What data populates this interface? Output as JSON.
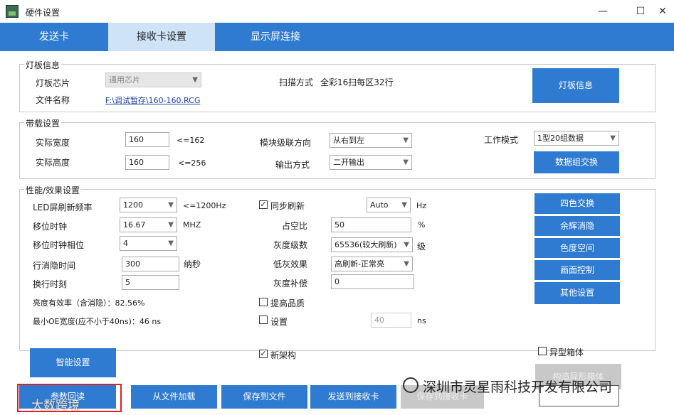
{
  "window": {
    "title": "硬件设置",
    "minimize": "—",
    "maximize": "☐",
    "close": "✕"
  },
  "tabs": [
    {
      "label": "发送卡"
    },
    {
      "label": "接收卡设置"
    },
    {
      "label": "显示屏连接"
    }
  ],
  "panel_info": {
    "legend": "灯板信息",
    "chip_label": "灯板芯片",
    "chip_value": "通用芯片",
    "file_label": "文件名称",
    "file_value": "F:\\调试暂存\\160-160.RCG",
    "scan_label": "扫描方式",
    "scan_value": "全彩16扫每区32行",
    "info_button": "灯板信息"
  },
  "panel_load": {
    "legend": "带载设置",
    "width_label": "实际宽度",
    "width_value": "160",
    "width_hint": "<=162",
    "height_label": "实际高度",
    "height_value": "160",
    "height_hint": "<=256",
    "cascade_label": "模块级联方向",
    "cascade_value": "从右到左",
    "output_label": "输出方式",
    "output_value": "二开输出",
    "mode_label": "工作模式",
    "mode_value": "1型20组数据",
    "swap_button": "数据组交换"
  },
  "panel_perf": {
    "legend": "性能/效果设置",
    "refresh_label": "LED屏刷新频率",
    "refresh_value": "1200",
    "refresh_hint": "<=1200Hz",
    "shift_clock_label": "移位时钟",
    "shift_clock_value": "16.67",
    "shift_clock_unit": "MHZ",
    "phase_label": "移位时钟相位",
    "phase_value": "4",
    "blank_label": "行消隐时间",
    "blank_value": "300",
    "blank_unit": "纳秒",
    "line_change_label": "换行时刻",
    "line_change_value": "5",
    "efficiency_text": "亮度有效率（含消隐）：82.56%",
    "min_oe_text": "最小OE宽度(应不小于40ns)：46 ns",
    "sync_label": "同步刷新",
    "sync_checked": true,
    "sync_value": "Auto",
    "sync_unit": "Hz",
    "duty_label": "占空比",
    "duty_value": "50",
    "duty_unit": "%",
    "gray_label": "灰度级数",
    "gray_value": "65536(较大刷新)",
    "gray_unit": "级",
    "lowgray_label": "低灰效果",
    "lowgray_value": "高刷新-正常亮",
    "graycomp_label": "灰度补偿",
    "graycomp_value": "0",
    "quality_label": "提高品质",
    "setting_label": "设置",
    "setting_value": "40",
    "setting_unit": "ns",
    "btn_four_color": "四色交换",
    "btn_afterglow": "余辉消隐",
    "btn_color_space": "色度空间",
    "btn_picture": "画面控制",
    "btn_other": "其他设置"
  },
  "bottom": {
    "smart_button": "智能设置",
    "new_arch_label": "新架构",
    "odd_box_label": "异型箱体",
    "odd_box_btn": "构造异形箱体",
    "read_back": "参数回读",
    "load_file": "从文件加载",
    "save_file": "保存到文件",
    "send_card": "发送到接收卡",
    "save_card": "保存到接收卡"
  },
  "watermarks": {
    "company": "深圳市灵星雨科技开发有限公司",
    "brand": "大数跨境"
  }
}
